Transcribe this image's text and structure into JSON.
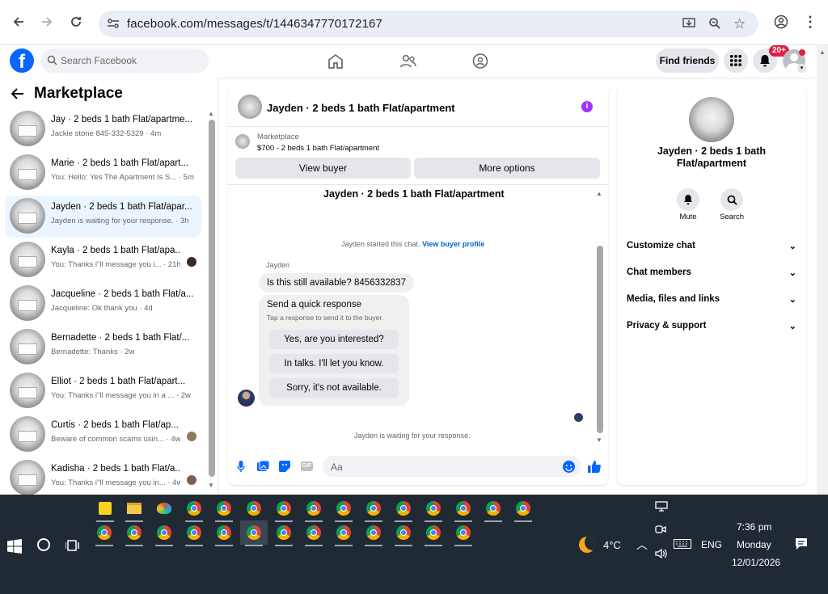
{
  "browser": {
    "url": "facebook.com/messages/t/1446347770172167"
  },
  "header": {
    "search_placeholder": "Search Facebook",
    "find_friends": "Find friends",
    "notif_badge": "20+"
  },
  "left": {
    "title": "Marketplace",
    "items": [
      {
        "name": "Jay · 2 beds 1 bath Flat/apartme...",
        "preview": "Jackie stone 845-332-5329 · 4m"
      },
      {
        "name": "Marie · 2 beds 1 bath Flat/apart...",
        "preview": "You: Hello: Yes The Apartment Is S... · 5m"
      },
      {
        "name": "Jayden · 2 beds 1 bath Flat/apar...",
        "preview": "Jayden is waiting for your response. · 3h"
      },
      {
        "name": "Kayla · 2 beds 1 bath Flat/apa...",
        "preview": "You: Thanks i\"ll message you i... · 21h"
      },
      {
        "name": "Jacqueline · 2 beds 1 bath Flat/a...",
        "preview": "Jacqueline: Ok thank you · 4d"
      },
      {
        "name": "Bernadette · 2 beds 1 bath Flat/...",
        "preview": "Bernadette: Thanks · 2w"
      },
      {
        "name": "Elliot · 2 beds 1 bath Flat/apart...",
        "preview": "You: Thanks i\"ll message you in a ... · 2w"
      },
      {
        "name": "Curtis · 2 beds 1 bath Flat/ap...",
        "preview": "Beware of common scams usin... · 4w"
      },
      {
        "name": "Kadisha · 2 beds 1 bath Flat/a...",
        "preview": "You: Thanks i\"ll message you in... · 4w"
      }
    ]
  },
  "chat": {
    "title": "Jayden · 2 beds 1 bath Flat/apartment",
    "listing_source": "Marketplace",
    "listing": "$700 - 2 beds 1 bath Flat/apartment",
    "view_buyer": "View buyer",
    "more_options": "More options",
    "thread_title": "Jayden · 2 beds 1 bath Flat/apartment",
    "started": "Jayden started this chat.",
    "view_profile": "View buyer profile",
    "sender": "Jayden",
    "message": "Is this still available? 8456332837",
    "quick_title": "Send a quick response",
    "quick_sub": "Tap a response to send it to the buyer.",
    "quick_1": "Yes, are you interested?",
    "quick_2": "In talks. I'll let you know.",
    "quick_3": "Sorry, it's not available.",
    "waiting": "Jayden is waiting for your response.",
    "input_placeholder": "Aa"
  },
  "right": {
    "name": "Jayden · 2 beds 1 bath Flat/apartment",
    "mute": "Mute",
    "search": "Search",
    "rows": [
      "Customize chat",
      "Chat members",
      "Media, files and links",
      "Privacy & support"
    ]
  },
  "taskbar": {
    "weather": "4°C",
    "lang": "ENG",
    "time": "7:36 pm",
    "day": "Monday",
    "date": "12/01/2026"
  }
}
